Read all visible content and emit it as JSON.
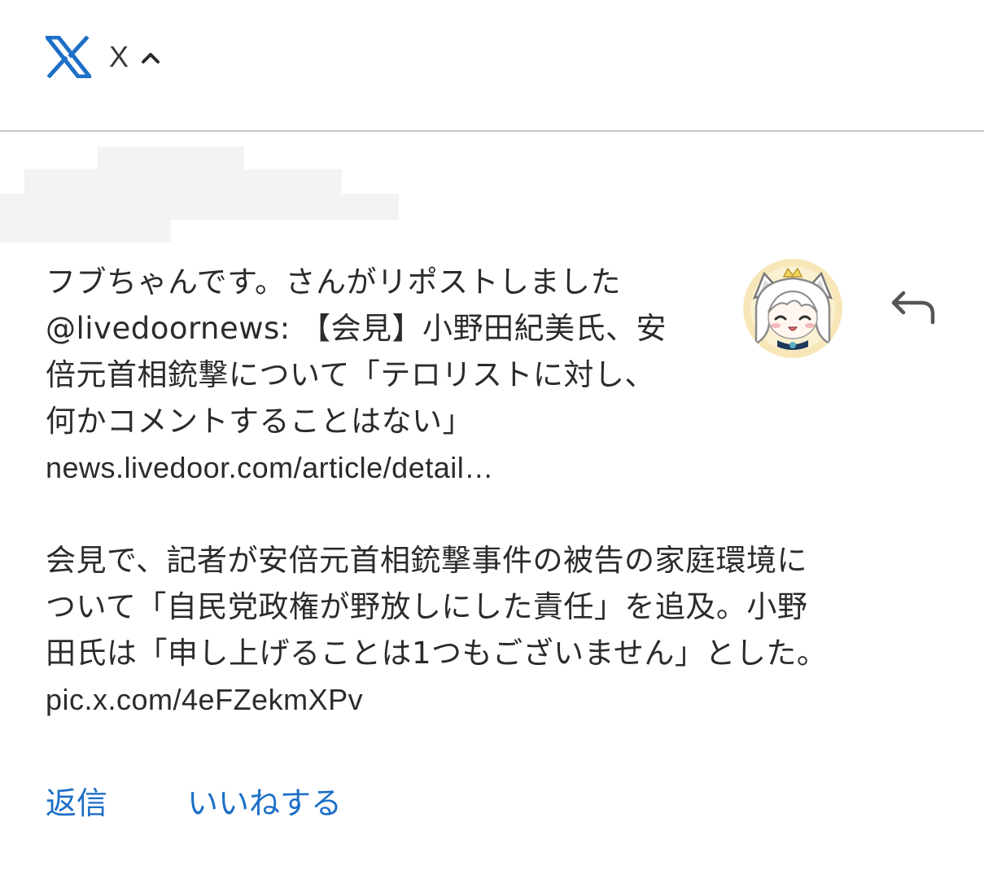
{
  "header": {
    "app_name": "X",
    "logo_icon": "x-logo-icon",
    "chevron_icon": "chevron-up-icon",
    "brand_color": "#1d6fc7"
  },
  "notification": {
    "title": "フブちゃんです。さんがリポストしました",
    "line2": "@livedoornews: 【会見】小野田紀美氏、安",
    "line3": "倍元首相銃撃について「テロリストに対し、",
    "line4": "何かコメントすることはない」",
    "link": "news.livedoor.com/article/detail…",
    "avatar_icon": "avatar-anime-character",
    "reply_icon": "reply-arrow-icon"
  },
  "post_body": {
    "line1": "会見で、記者が安倍元首相銃撃事件の被告の家庭環境に",
    "line2": "ついて「自民党政権が野放しにした責任」を追及。小野",
    "line3": "田氏は「申し上げることは1つもございません」とした。",
    "link": "pic.x.com/4eFZekmXPv"
  },
  "actions": {
    "reply_label": "返信",
    "like_label": "いいねする",
    "action_color": "#1d6fc7"
  }
}
